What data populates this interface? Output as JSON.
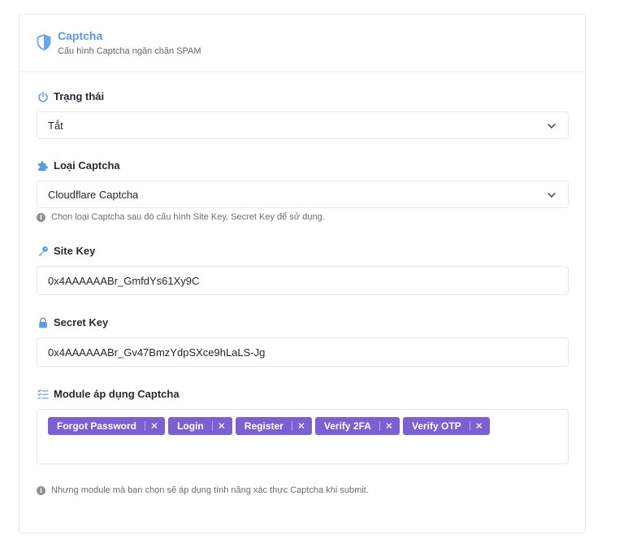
{
  "header": {
    "title": "Captcha",
    "subtitle": "Cấu hình Captcha ngăn chặn SPAM"
  },
  "status": {
    "label": "Trạng thái",
    "value": "Tắt"
  },
  "captcha_type": {
    "label": "Loại Captcha",
    "value": "Cloudflare Captcha",
    "help": "Chọn loại Captcha sau đó cấu hình Site Key, Secret Key để sử dụng."
  },
  "site_key": {
    "label": "Site Key",
    "value": "0x4AAAAAABr_GmfdYs61Xy9C"
  },
  "secret_key": {
    "label": "Secret Key",
    "value": "0x4AAAAAABr_Gv47BmzYdpSXce9hLaLS-Jg"
  },
  "modules": {
    "label": "Module áp dụng Captcha",
    "tags": [
      "Forgot Password",
      "Login",
      "Register",
      "Verify 2FA",
      "Verify OTP"
    ],
    "remove_glyph": "✕",
    "help": "Nhưng module mà bạn chọn sẽ áp dụng tính năng xác thực Captcha khi submit."
  },
  "colors": {
    "accent": "#5b9be6",
    "tag_bg": "#7c5fd3",
    "border": "#e3e6eb"
  },
  "icons": {
    "header": "shield-icon",
    "status": "power-icon",
    "captcha_type": "puzzle-icon",
    "site_key": "key-icon",
    "secret_key": "lock-icon",
    "modules": "checklist-icon",
    "help": "info-icon",
    "select": "chevron-down-icon"
  }
}
